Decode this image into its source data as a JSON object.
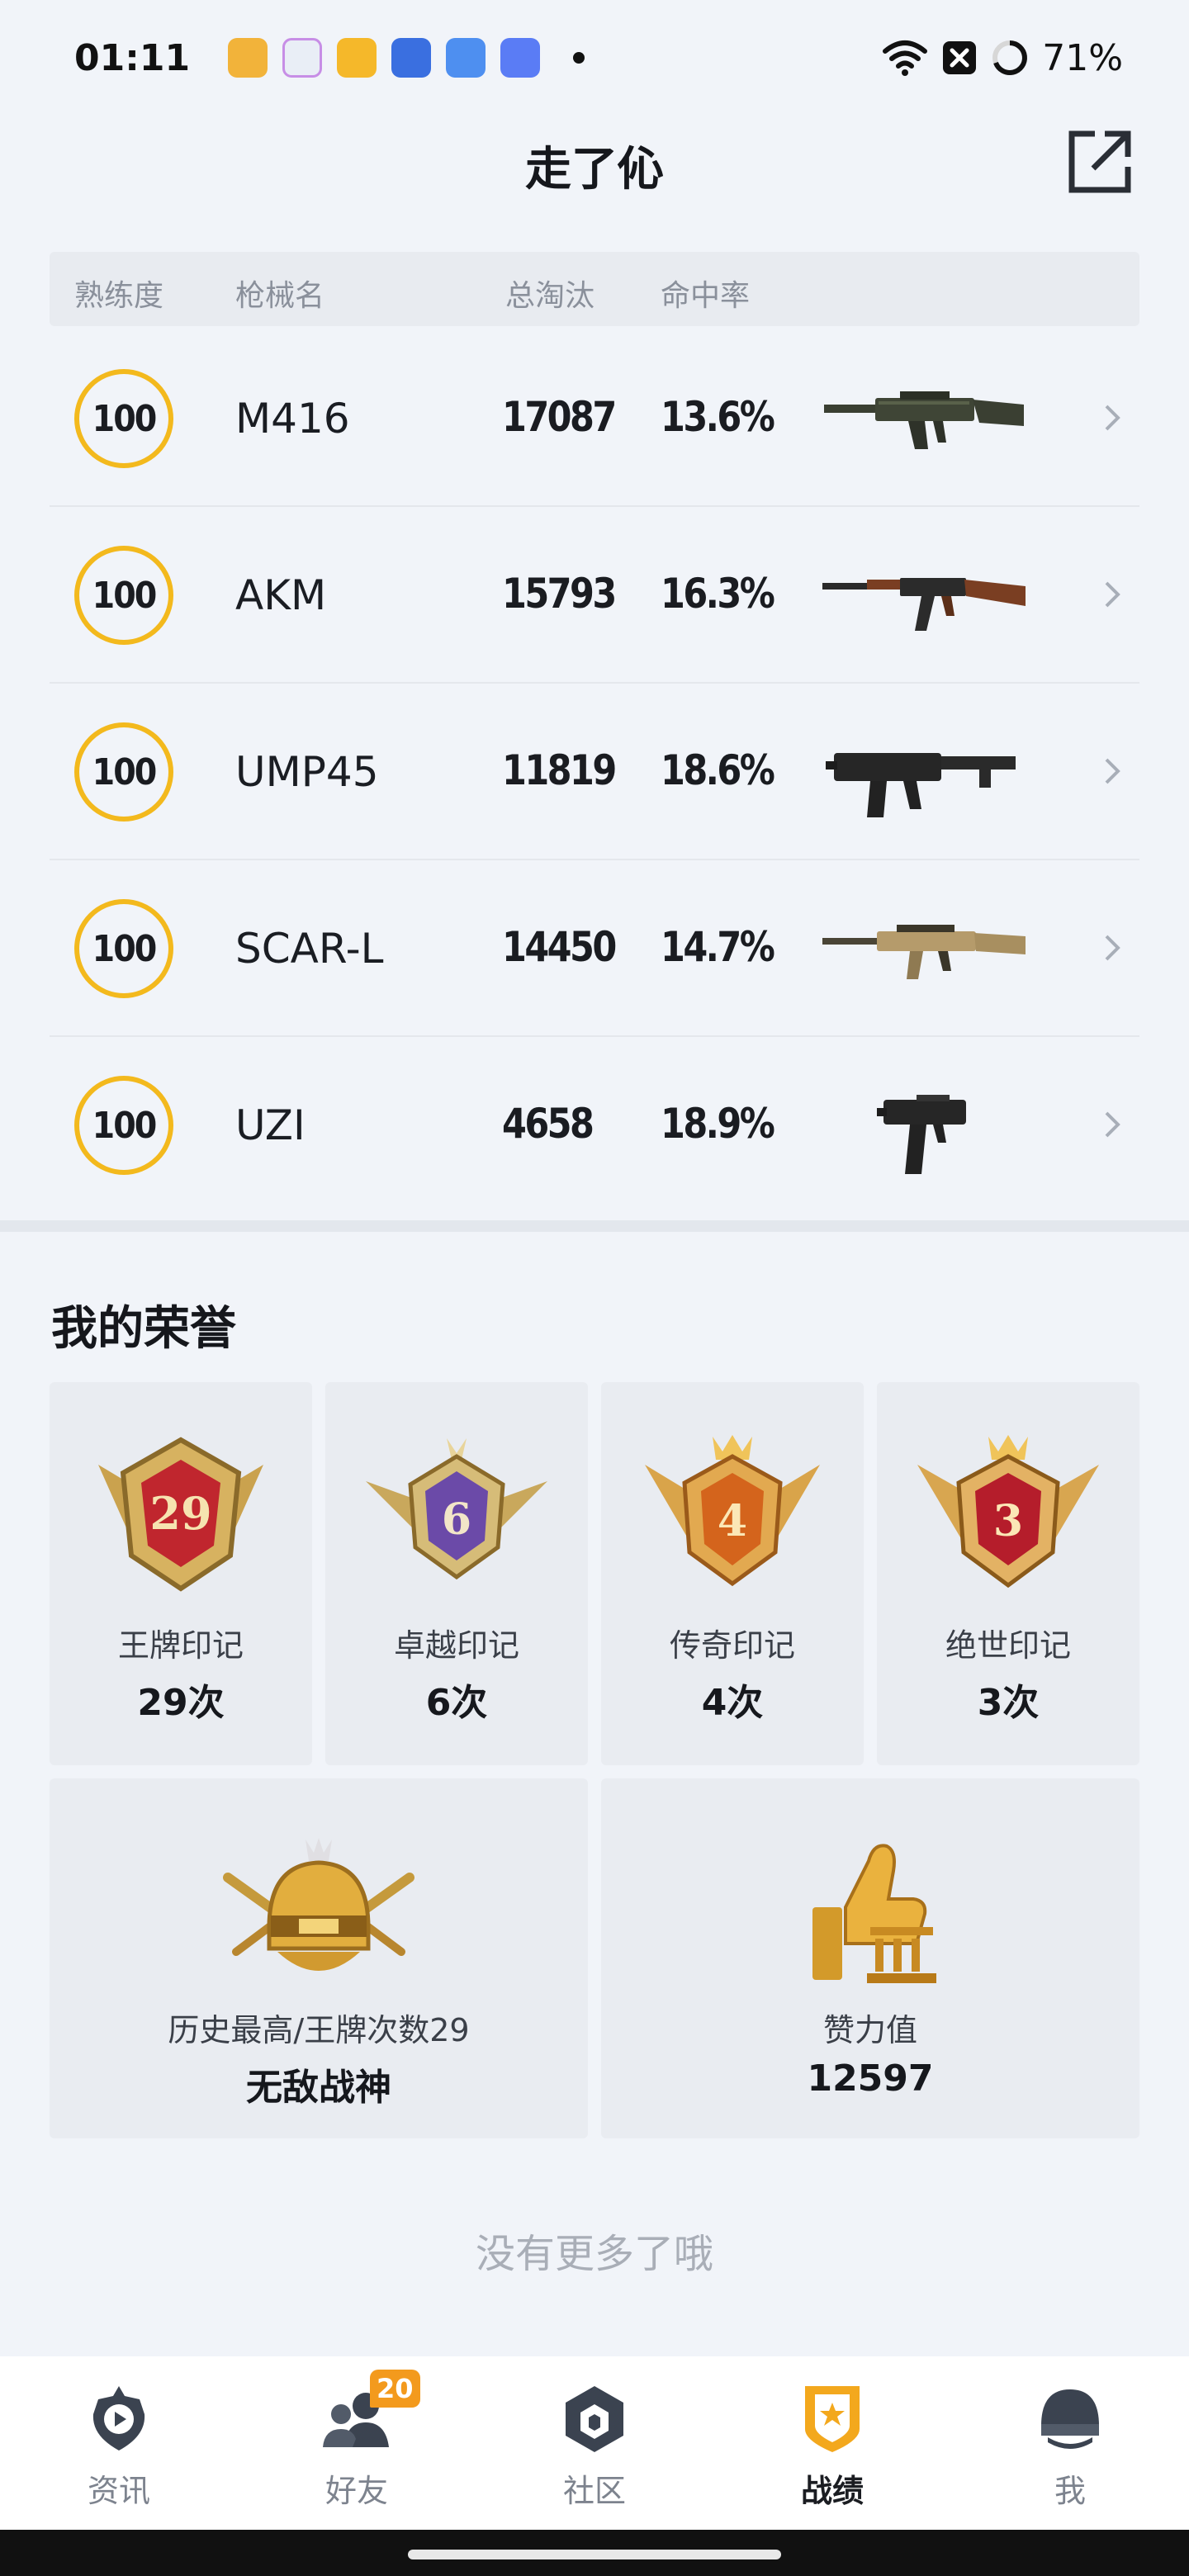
{
  "status_bar": {
    "time": "01:11",
    "battery": "71%",
    "app_icon_colors": [
      "#f2b33a",
      "#e9eef6",
      "#f5b82a",
      "#3a6fe0",
      "#4e8ff0",
      "#5a7cf5"
    ]
  },
  "header": {
    "title": "走了伈",
    "share_icon": "share-external-icon"
  },
  "table": {
    "columns": [
      "熟练度",
      "枪械名",
      "总淘汰",
      "命中率"
    ],
    "rows": [
      {
        "mastery": "100",
        "name": "M416",
        "kills": "17087",
        "hit_rate": "13.6%",
        "icon": "m416-rifle"
      },
      {
        "mastery": "100",
        "name": "AKM",
        "kills": "15793",
        "hit_rate": "16.3%",
        "icon": "akm-rifle"
      },
      {
        "mastery": "100",
        "name": "UMP45",
        "kills": "11819",
        "hit_rate": "18.6%",
        "icon": "ump45-smg"
      },
      {
        "mastery": "100",
        "name": "SCAR-L",
        "kills": "14450",
        "hit_rate": "14.7%",
        "icon": "scar-l-rifle"
      },
      {
        "mastery": "100",
        "name": "UZI",
        "kills": "4658",
        "hit_rate": "18.9%",
        "icon": "uzi-smg"
      }
    ]
  },
  "honors": {
    "title": "我的荣誉",
    "badges": [
      {
        "label": "王牌印记",
        "count": "29次",
        "badge_number": "29",
        "color": "#c0262e"
      },
      {
        "label": "卓越印记",
        "count": "6次",
        "badge_number": "6",
        "color": "#6b4aa8"
      },
      {
        "label": "传奇印记",
        "count": "4次",
        "badge_number": "4",
        "color": "#d4641c"
      },
      {
        "label": "绝世印记",
        "count": "3次",
        "badge_number": "3",
        "color": "#b51d2b"
      }
    ],
    "stats": [
      {
        "label": "历史最高/王牌次数29",
        "value": "无敌战神",
        "icon": "helmet-crown-icon"
      },
      {
        "label": "赞力值",
        "value": "12597",
        "icon": "thumbs-up-icon"
      }
    ]
  },
  "footer_text": "没有更多了哦",
  "bottom_nav": {
    "items": [
      {
        "label": "资讯",
        "icon": "news-icon",
        "active": false
      },
      {
        "label": "好友",
        "icon": "friends-icon",
        "active": false,
        "badge": "20"
      },
      {
        "label": "社区",
        "icon": "community-icon",
        "active": false
      },
      {
        "label": "战绩",
        "icon": "record-icon",
        "active": true
      },
      {
        "label": "我",
        "icon": "me-icon",
        "active": false
      }
    ],
    "accent_color": "#f3a81d"
  }
}
